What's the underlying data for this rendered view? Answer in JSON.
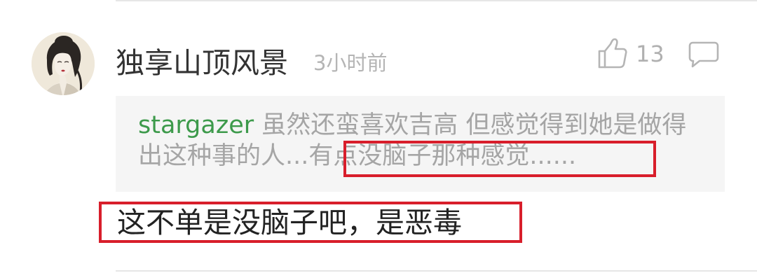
{
  "comment": {
    "username": "独享山顶风景",
    "time": "3小时前",
    "like_count": "13",
    "quote": {
      "author": "stargazer",
      "text": " 虽然还蛮喜欢吉高 但感觉得到她是做得出这种事的人...有点没脑子那种感觉......"
    },
    "reply": "这不单是没脑子吧，是恶毒"
  },
  "icons": {
    "like": "thumbs-up-icon",
    "comment": "speech-bubble-icon"
  },
  "colors": {
    "author_green": "#3d9a4b",
    "highlight_red": "#d81e2b",
    "quote_background": "#f5f5f5"
  }
}
